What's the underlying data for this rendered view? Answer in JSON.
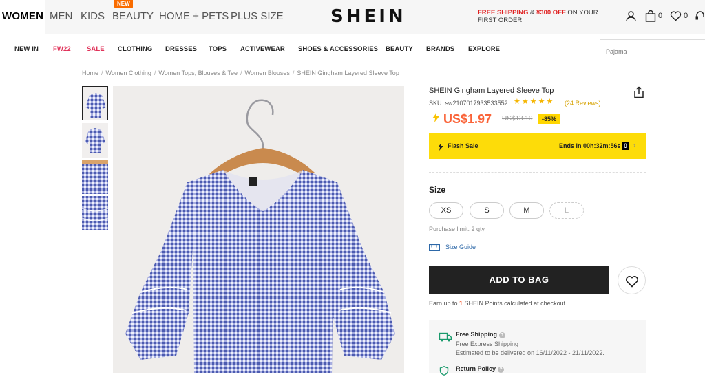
{
  "header": {
    "top_nav": [
      {
        "label": "WOMEN"
      },
      {
        "label": "MEN"
      },
      {
        "label": "KIDS"
      },
      {
        "label": "BEAUTY"
      },
      {
        "label": "HOME + PETS"
      },
      {
        "label": "PLUS SIZE"
      }
    ],
    "new_badge": "NEW",
    "logo": "SHEIN",
    "promo": {
      "part1": "FREE SHIPPING",
      "amp": " & ",
      "part2": "¥300 OFF",
      "part3": " ON YOUR FIRST ORDER"
    },
    "bag_count": "0",
    "wishlist_count": "0"
  },
  "category_nav": {
    "items": [
      "NEW IN",
      "FW22",
      "SALE",
      "CLOTHING",
      "DRESSES",
      "TOPS",
      "ACTIVEWEAR",
      "SHOES & ACCESSORIES",
      "BEAUTY",
      "BRANDS",
      "EXPLORE"
    ],
    "search_placeholder": "Pajama"
  },
  "breadcrumb": [
    "Home",
    "Women Clothing",
    "Women Tops, Blouses & Tee",
    "Women Blouses",
    "SHEIN Gingham Layered Sleeve Top"
  ],
  "product": {
    "title": "SHEIN Gingham Layered Sleeve Top",
    "sku": "SKU: sw2107017933533552",
    "stars": "★★★★★",
    "rating": 4.5,
    "reviews": "(24 Reviews)",
    "price": "US$1.97",
    "old_price": "US$13.10",
    "discount": "-85%",
    "flash_label": "Flash Sale",
    "flash_ends": "Ends in 00h:32m:56s",
    "flash_seconds_box": "0",
    "size_label": "Size",
    "sizes": [
      "XS",
      "S",
      "M",
      "L"
    ],
    "purchase_limit": "Purchase limit: 2 qty",
    "size_guide": "Size Guide",
    "add_to_bag": "ADD TO BAG",
    "points_pre": "Earn up to ",
    "points_num": "1",
    "points_post": " SHEIN Points calculated at checkout.",
    "free_shipping_title": "Free Shipping",
    "free_shipping_sub1": "Free Express Shipping",
    "free_shipping_sub2": "Estimated to be delivered on 16/11/2022 - 21/11/2022.",
    "return_policy_title": "Return Policy"
  },
  "colors": {
    "price_orange": "#fa6338",
    "flash_yellow": "#fddc09",
    "accent_pink": "#e0335a",
    "gingham_blue": "#6c7cc4"
  }
}
